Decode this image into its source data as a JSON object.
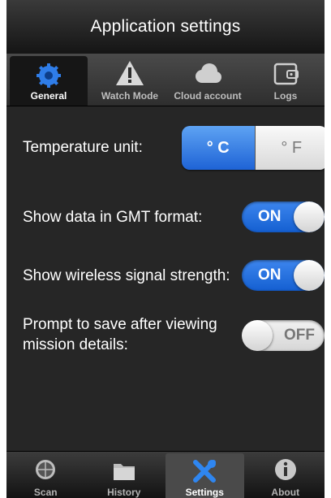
{
  "title": "Application settings",
  "top_tabs": [
    {
      "label": "General",
      "icon": "gear-icon",
      "active": true
    },
    {
      "label": "Watch Mode",
      "icon": "warning-icon",
      "active": false
    },
    {
      "label": "Cloud account",
      "icon": "cloud-icon",
      "active": false
    },
    {
      "label": "Logs",
      "icon": "wallet-icon",
      "active": false
    }
  ],
  "settings": {
    "temperature": {
      "label": "Temperature unit:",
      "celsius": "° C",
      "fahrenheit": "° F",
      "selected": "celsius"
    },
    "gmt": {
      "label": "Show data in GMT format:",
      "state": "ON"
    },
    "signal": {
      "label": "Show wireless signal strength:",
      "state": "ON"
    },
    "prompt": {
      "label_line1": "Prompt to save after viewing",
      "label_line2": "mission details:",
      "state": "OFF"
    }
  },
  "bottom_tabs": [
    {
      "label": "Scan",
      "icon": "radar-icon",
      "active": false
    },
    {
      "label": "History",
      "icon": "folder-icon",
      "active": false
    },
    {
      "label": "Settings",
      "icon": "tools-icon",
      "active": true
    },
    {
      "label": "About",
      "icon": "info-icon",
      "active": false
    }
  ],
  "colors": {
    "accent": "#1e63d6",
    "background": "#262626"
  }
}
